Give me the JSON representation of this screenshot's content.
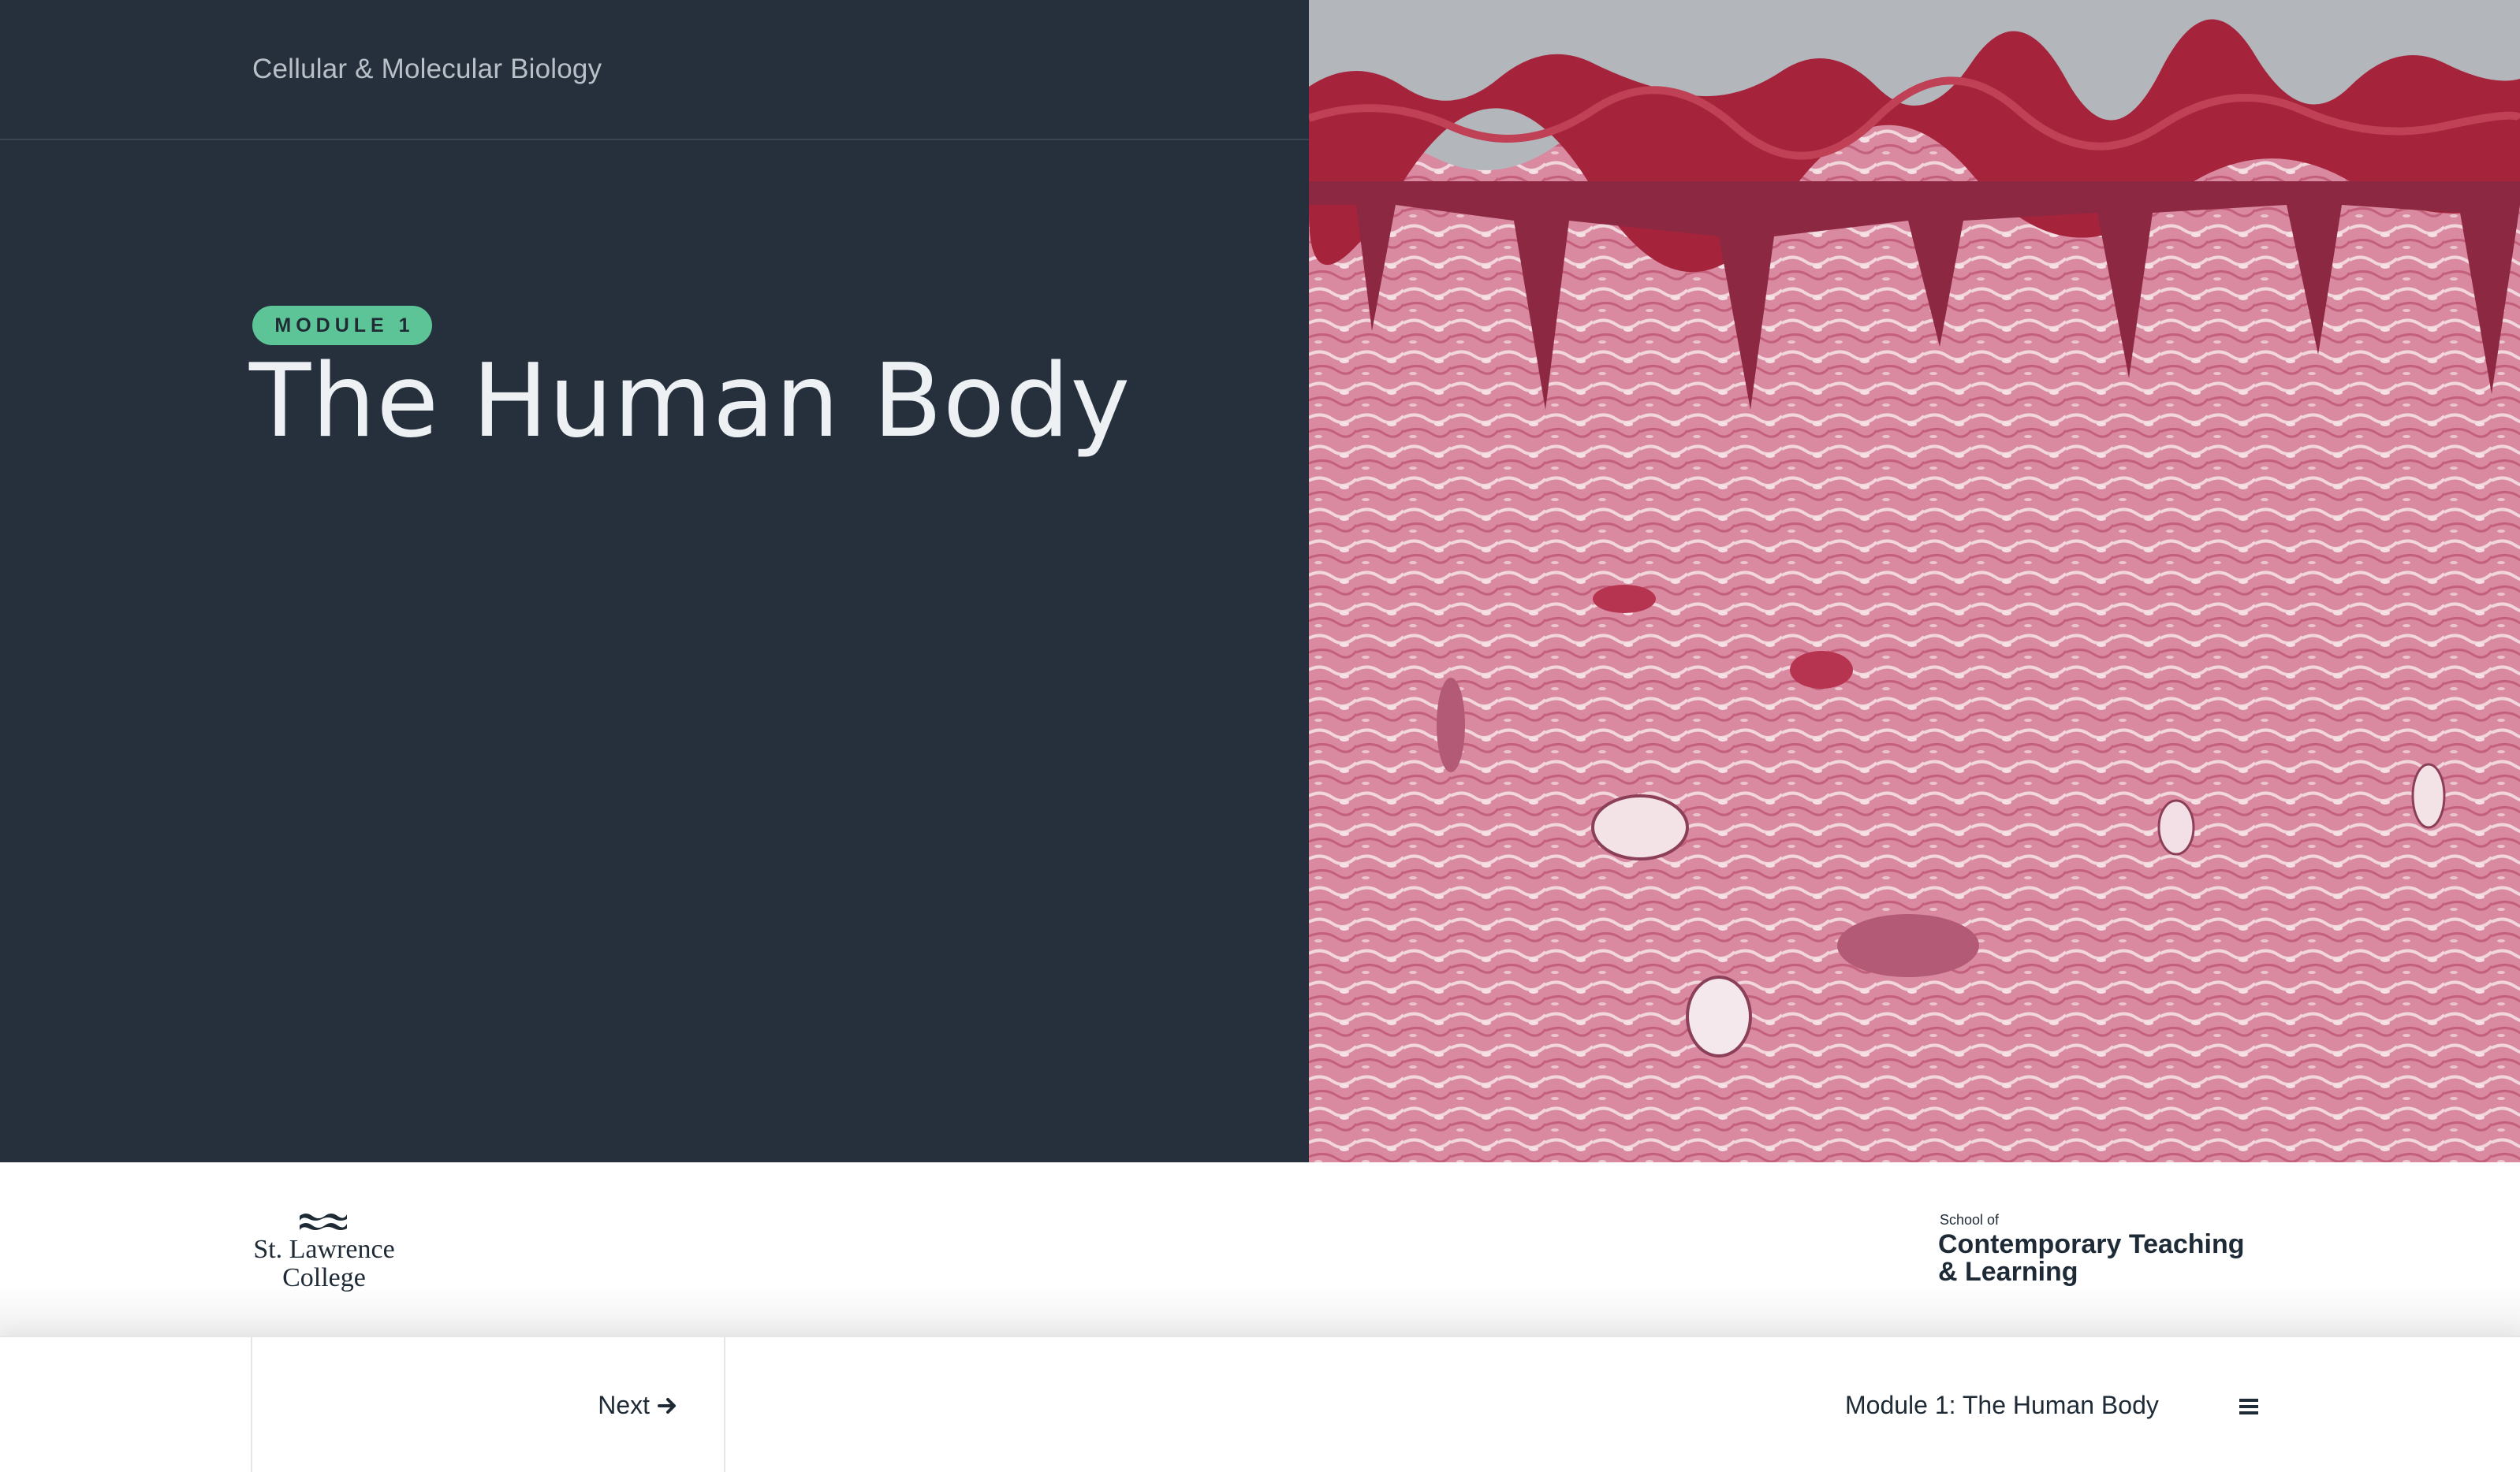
{
  "header": {
    "course_title": "Cellular & Molecular Biology"
  },
  "hero": {
    "badge": "MODULE 1",
    "title": "The Human Body",
    "image_subject": "skin-histology-image"
  },
  "logos": {
    "left": {
      "line1": "St. Lawrence",
      "line2": "College"
    },
    "right": {
      "small": "School of",
      "line1": "Contemporary Teaching",
      "line2": "& Learning"
    }
  },
  "nav": {
    "next_label": "Next",
    "module_label": "Module 1: The Human Body",
    "menu_icon": "hamburger-menu-icon"
  },
  "colors": {
    "hero_bg": "#26303d",
    "badge_bg": "#5cc496",
    "text_dark": "#1e2a36",
    "tissue_pink": "#d9768f",
    "tissue_dark": "#a5243c"
  }
}
